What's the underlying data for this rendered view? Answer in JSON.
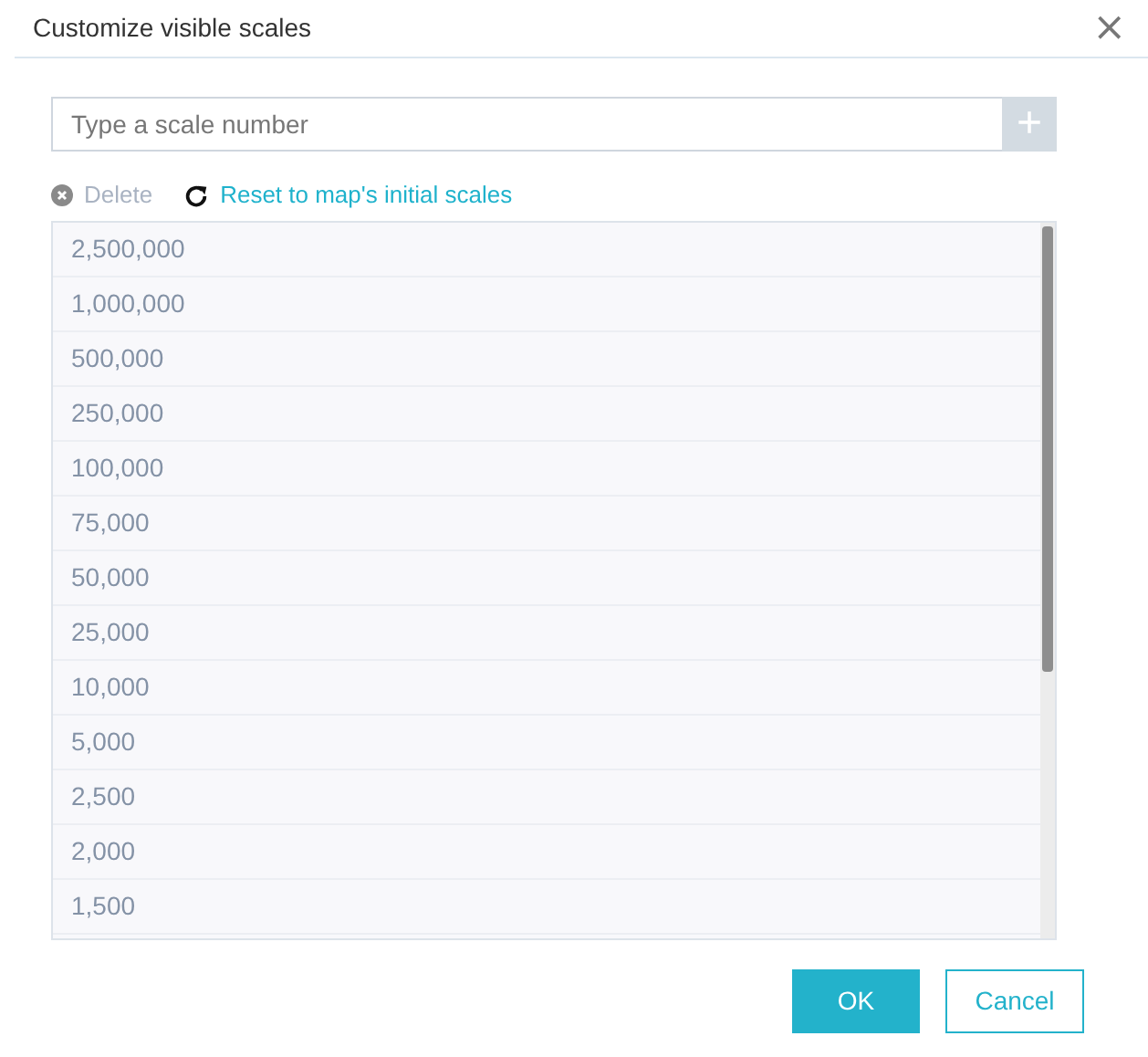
{
  "window": {
    "title": "Customize visible scales",
    "close": "×"
  },
  "input": {
    "placeholder": "Type a scale number",
    "add_button": "+"
  },
  "actions": [
    {
      "kind": "delete",
      "label": "Delete",
      "disabled": true
    },
    {
      "kind": "reset",
      "label": "Reset to map's initial scales",
      "disabled": false
    }
  ],
  "scales": [
    "2,500,000",
    "1,000,000",
    "500,000",
    "250,000",
    "100,000",
    "75,000",
    "50,000",
    "25,000",
    "10,000",
    "5,000",
    "2,500",
    "2,000",
    "1,500"
  ],
  "buttons": [
    {
      "kind": "primary",
      "label": "OK"
    },
    {
      "kind": "secondary",
      "label": "Cancel"
    }
  ]
}
